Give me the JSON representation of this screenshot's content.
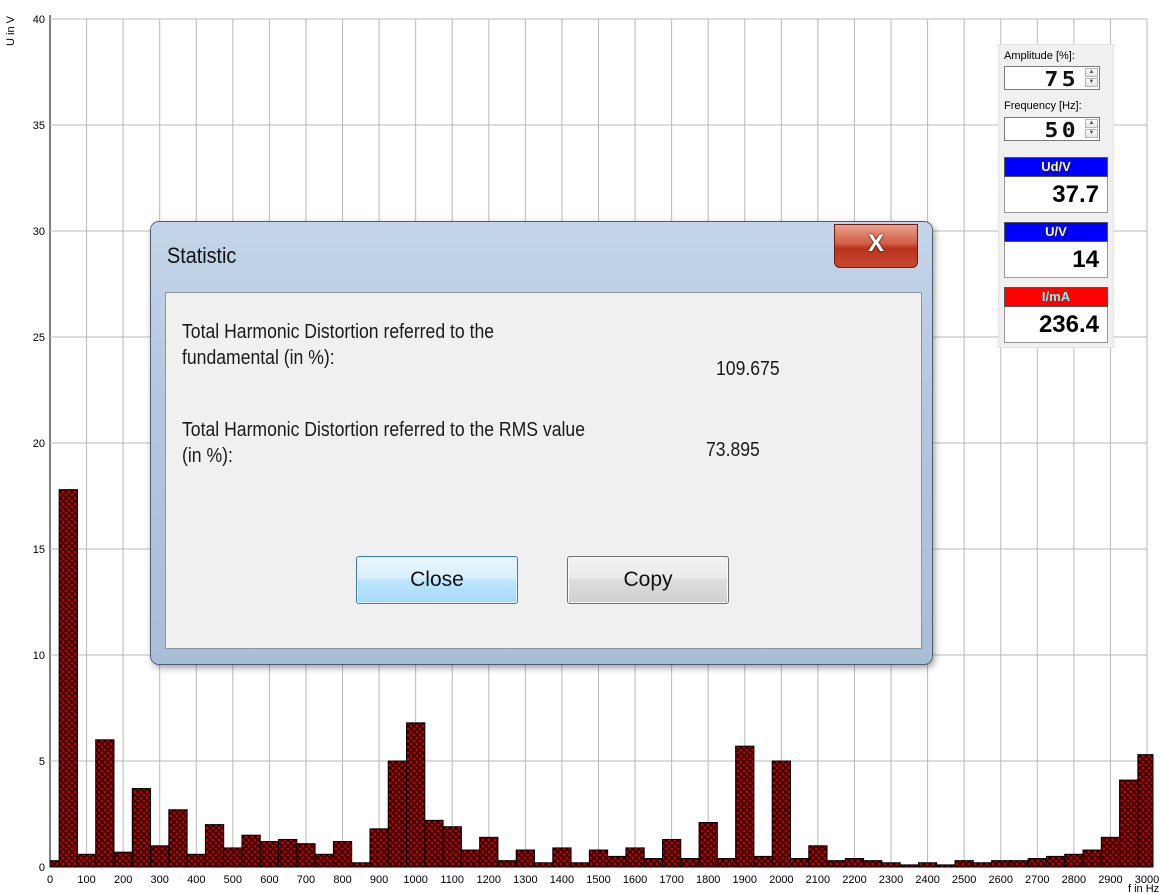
{
  "chart_data": {
    "type": "bar",
    "ylabel": "U in V",
    "xlabel": "f in Hz",
    "xlim": [
      0,
      3000
    ],
    "ylim": [
      0,
      40
    ],
    "yticks": [
      0,
      5,
      10,
      15,
      20,
      25,
      30,
      35,
      40
    ],
    "xticks": [
      0,
      100,
      200,
      300,
      400,
      500,
      600,
      700,
      800,
      900,
      1000,
      1100,
      1200,
      1300,
      1400,
      1500,
      1600,
      1700,
      1800,
      1900,
      2000,
      2100,
      2200,
      2300,
      2400,
      2500,
      2600,
      2700,
      2800,
      2900,
      3000
    ],
    "grid": true,
    "bar_fill": "#c00000",
    "bar_edge": "#000000",
    "x": [
      0,
      50,
      100,
      150,
      200,
      250,
      300,
      350,
      400,
      450,
      500,
      550,
      600,
      650,
      700,
      750,
      800,
      850,
      900,
      950,
      1000,
      1050,
      1100,
      1150,
      1200,
      1250,
      1300,
      1350,
      1400,
      1450,
      1500,
      1550,
      1600,
      1650,
      1700,
      1750,
      1800,
      1850,
      1900,
      1950,
      2000,
      2050,
      2100,
      2150,
      2200,
      2250,
      2300,
      2350,
      2400,
      2450,
      2500,
      2550,
      2600,
      2650,
      2700,
      2750,
      2800,
      2850,
      2900,
      2950,
      3000
    ],
    "values": [
      0.3,
      17.8,
      0.6,
      6.0,
      0.7,
      3.7,
      1.0,
      2.7,
      0.6,
      2.0,
      0.9,
      1.5,
      1.2,
      1.3,
      1.1,
      0.6,
      1.2,
      0.2,
      1.8,
      5.0,
      6.8,
      2.2,
      1.9,
      0.8,
      1.4,
      0.3,
      0.8,
      0.2,
      0.9,
      0.2,
      0.8,
      0.5,
      0.9,
      0.4,
      1.3,
      0.4,
      2.1,
      0.4,
      5.7,
      0.5,
      5.0,
      0.4,
      1.0,
      0.3,
      0.4,
      0.3,
      0.2,
      0.1,
      0.2,
      0.1,
      0.3,
      0.2,
      0.3,
      0.3,
      0.4,
      0.5,
      0.6,
      0.8,
      1.4,
      4.1,
      5.3
    ]
  },
  "panel": {
    "amplitude_label": "Amplitude [%]:",
    "amplitude_value": "75",
    "frequency_label": "Frequency [Hz]:",
    "frequency_value": "50",
    "ud_label": "Ud/V",
    "ud_value": "37.7",
    "ud_color": "#0000ff",
    "u_label": "U/V",
    "u_value": "14",
    "u_color": "#0000ff",
    "i_label": "I/mA",
    "i_value": "236.4",
    "i_color": "#ff0000"
  },
  "dialog": {
    "title": "Statistic",
    "close_x": "X",
    "thd_fund_line1": "Total Harmonic Distortion referred to the",
    "thd_fund_line2": "fundamental (in %):",
    "thd_fund_value": "109.675",
    "thd_rms_line1": "Total Harmonic Distortion referred to the RMS value",
    "thd_rms_line2": "(in %):",
    "thd_rms_value": "73.895",
    "close_button": "Close",
    "copy_button": "Copy"
  }
}
